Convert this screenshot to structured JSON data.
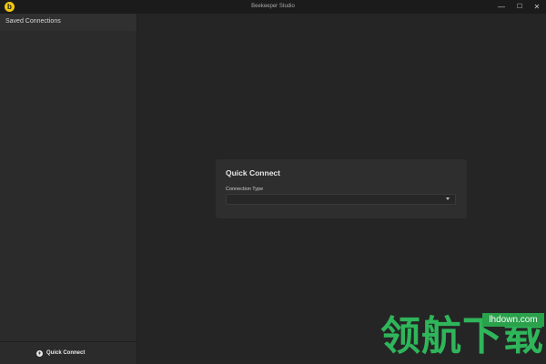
{
  "window": {
    "title": "Beekeeper Studio",
    "logo_letter": "b",
    "controls": {
      "minimize": "—",
      "maximize": "☐",
      "close": "✕"
    }
  },
  "sidebar": {
    "header": "Saved Connections",
    "footer_button": "Quick Connect"
  },
  "main": {
    "card_title": "Quick Connect",
    "connection_type_label": "Connection Type",
    "connection_type_value": ""
  },
  "watermark": {
    "site": "lhdown.com",
    "text": "领航下载"
  },
  "colors": {
    "brand": "#f2c80f",
    "background": "#252525",
    "sidebar": "#2b2b2b",
    "watermark": "#2fb55a"
  }
}
